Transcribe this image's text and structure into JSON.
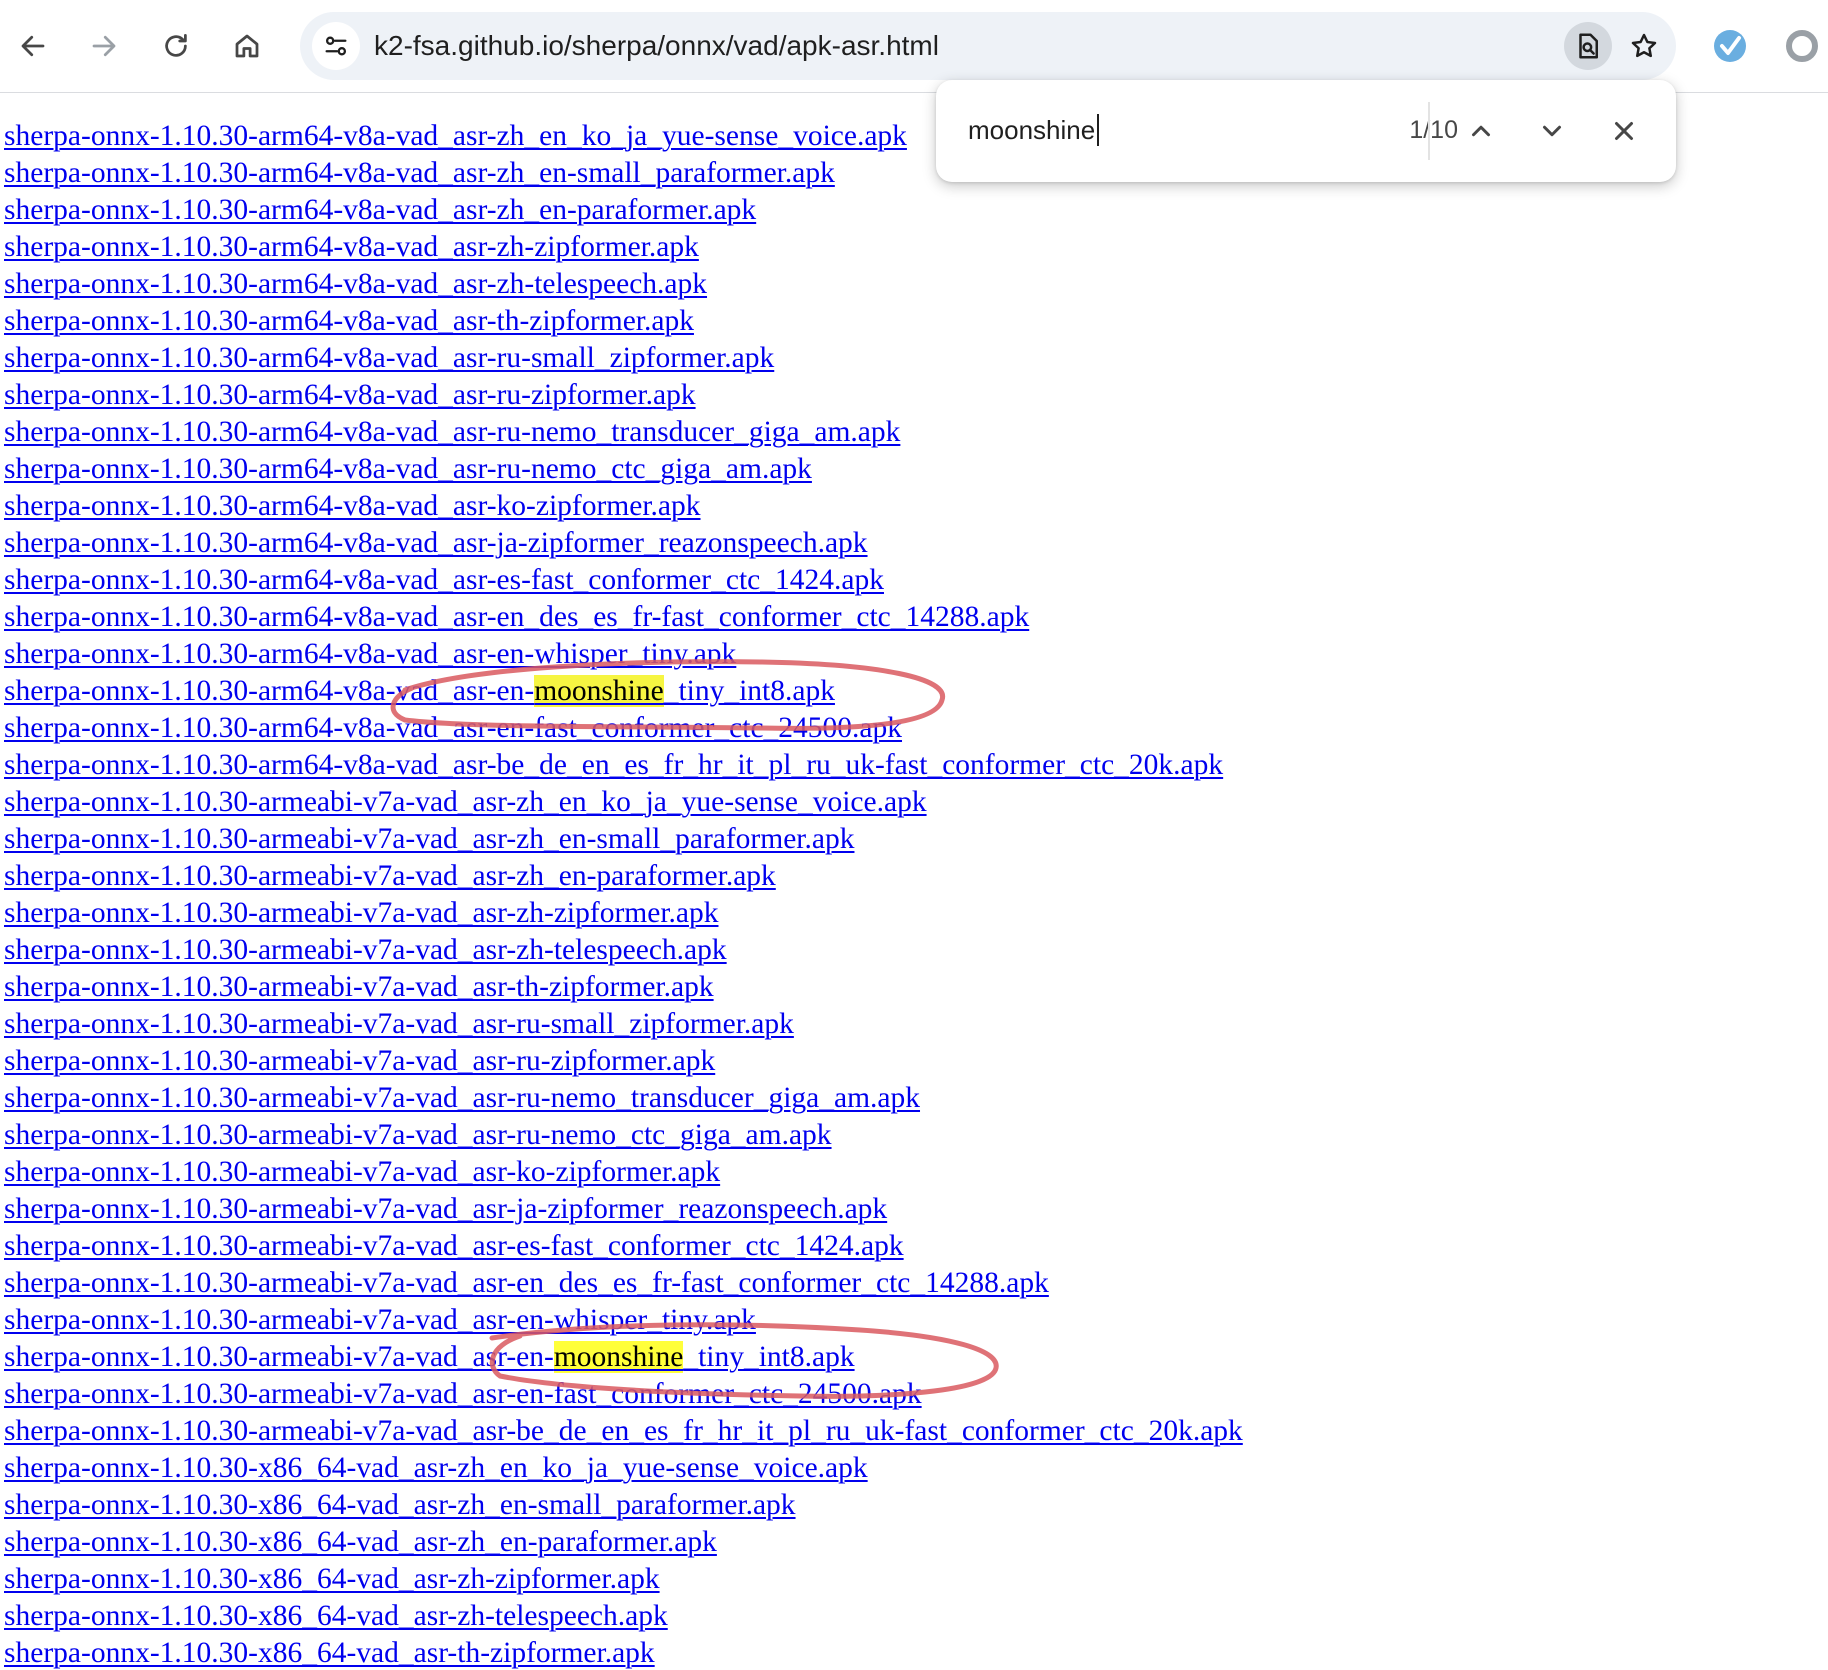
{
  "browser": {
    "url": "k2-fsa.github.io/sherpa/onnx/vad/apk-asr.html",
    "icons": {
      "back": "arrow-left-icon",
      "forward": "arrow-right-icon",
      "reload": "reload-icon",
      "home": "home-icon",
      "site_info": "tune-icon",
      "page_search": "find-in-page-icon",
      "bookmark": "star-icon",
      "extension_1": "extension-check-icon",
      "extension_2": "extension-circle-icon"
    }
  },
  "find_bar": {
    "query": "moonshine",
    "count": "1/10",
    "icons": {
      "previous": "chevron-up-icon",
      "next": "chevron-down-icon",
      "close": "close-icon"
    }
  },
  "colors": {
    "link": "#0000ee",
    "highlight": "#ffff3a",
    "annotation": "#d9595f"
  },
  "links": [
    {
      "text": "sherpa-onnx-1.10.30-arm64-v8a-vad_asr-zh_en_ko_ja_yue-sense_voice.apk"
    },
    {
      "text": "sherpa-onnx-1.10.30-arm64-v8a-vad_asr-zh_en-small_paraformer.apk"
    },
    {
      "text": "sherpa-onnx-1.10.30-arm64-v8a-vad_asr-zh_en-paraformer.apk"
    },
    {
      "text": "sherpa-onnx-1.10.30-arm64-v8a-vad_asr-zh-zipformer.apk"
    },
    {
      "text": "sherpa-onnx-1.10.30-arm64-v8a-vad_asr-zh-telespeech.apk"
    },
    {
      "text": "sherpa-onnx-1.10.30-arm64-v8a-vad_asr-th-zipformer.apk"
    },
    {
      "text": "sherpa-onnx-1.10.30-arm64-v8a-vad_asr-ru-small_zipformer.apk"
    },
    {
      "text": "sherpa-onnx-1.10.30-arm64-v8a-vad_asr-ru-zipformer.apk"
    },
    {
      "text": "sherpa-onnx-1.10.30-arm64-v8a-vad_asr-ru-nemo_transducer_giga_am.apk"
    },
    {
      "text": "sherpa-onnx-1.10.30-arm64-v8a-vad_asr-ru-nemo_ctc_giga_am.apk"
    },
    {
      "text": "sherpa-onnx-1.10.30-arm64-v8a-vad_asr-ko-zipformer.apk"
    },
    {
      "text": "sherpa-onnx-1.10.30-arm64-v8a-vad_asr-ja-zipformer_reazonspeech.apk"
    },
    {
      "text": "sherpa-onnx-1.10.30-arm64-v8a-vad_asr-es-fast_conformer_ctc_1424.apk"
    },
    {
      "text": "sherpa-onnx-1.10.30-arm64-v8a-vad_asr-en_des_es_fr-fast_conformer_ctc_14288.apk"
    },
    {
      "text": "sherpa-onnx-1.10.30-arm64-v8a-vad_asr-en-whisper_tiny.apk"
    },
    {
      "pre": "sherpa-onnx-1.10.30-arm64-v8a-vad_asr-en-",
      "match": "moonshine",
      "post": "_tiny_int8.apk",
      "current": true
    },
    {
      "text": "sherpa-onnx-1.10.30-arm64-v8a-vad_asr-en-fast_conformer_ctc_24500.apk"
    },
    {
      "text": "sherpa-onnx-1.10.30-arm64-v8a-vad_asr-be_de_en_es_fr_hr_it_pl_ru_uk-fast_conformer_ctc_20k.apk"
    },
    {
      "text": "sherpa-onnx-1.10.30-armeabi-v7a-vad_asr-zh_en_ko_ja_yue-sense_voice.apk"
    },
    {
      "text": "sherpa-onnx-1.10.30-armeabi-v7a-vad_asr-zh_en-small_paraformer.apk"
    },
    {
      "text": "sherpa-onnx-1.10.30-armeabi-v7a-vad_asr-zh_en-paraformer.apk"
    },
    {
      "text": "sherpa-onnx-1.10.30-armeabi-v7a-vad_asr-zh-zipformer.apk"
    },
    {
      "text": "sherpa-onnx-1.10.30-armeabi-v7a-vad_asr-zh-telespeech.apk"
    },
    {
      "text": "sherpa-onnx-1.10.30-armeabi-v7a-vad_asr-th-zipformer.apk"
    },
    {
      "text": "sherpa-onnx-1.10.30-armeabi-v7a-vad_asr-ru-small_zipformer.apk"
    },
    {
      "text": "sherpa-onnx-1.10.30-armeabi-v7a-vad_asr-ru-zipformer.apk"
    },
    {
      "text": "sherpa-onnx-1.10.30-armeabi-v7a-vad_asr-ru-nemo_transducer_giga_am.apk"
    },
    {
      "text": "sherpa-onnx-1.10.30-armeabi-v7a-vad_asr-ru-nemo_ctc_giga_am.apk"
    },
    {
      "text": "sherpa-onnx-1.10.30-armeabi-v7a-vad_asr-ko-zipformer.apk"
    },
    {
      "text": "sherpa-onnx-1.10.30-armeabi-v7a-vad_asr-ja-zipformer_reazonspeech.apk"
    },
    {
      "text": "sherpa-onnx-1.10.30-armeabi-v7a-vad_asr-es-fast_conformer_ctc_1424.apk"
    },
    {
      "text": "sherpa-onnx-1.10.30-armeabi-v7a-vad_asr-en_des_es_fr-fast_conformer_ctc_14288.apk"
    },
    {
      "text": "sherpa-onnx-1.10.30-armeabi-v7a-vad_asr-en-whisper_tiny.apk"
    },
    {
      "pre": "sherpa-onnx-1.10.30-armeabi-v7a-vad_asr-en-",
      "match": "moonshine",
      "post": "_tiny_int8.apk"
    },
    {
      "text": "sherpa-onnx-1.10.30-armeabi-v7a-vad_asr-en-fast_conformer_ctc_24500.apk"
    },
    {
      "text": "sherpa-onnx-1.10.30-armeabi-v7a-vad_asr-be_de_en_es_fr_hr_it_pl_ru_uk-fast_conformer_ctc_20k.apk"
    },
    {
      "text": "sherpa-onnx-1.10.30-x86_64-vad_asr-zh_en_ko_ja_yue-sense_voice.apk"
    },
    {
      "text": "sherpa-onnx-1.10.30-x86_64-vad_asr-zh_en-small_paraformer.apk"
    },
    {
      "text": "sherpa-onnx-1.10.30-x86_64-vad_asr-zh_en-paraformer.apk"
    },
    {
      "text": "sherpa-onnx-1.10.30-x86_64-vad_asr-zh-zipformer.apk"
    },
    {
      "text": "sherpa-onnx-1.10.30-x86_64-vad_asr-zh-telespeech.apk"
    },
    {
      "text": "sherpa-onnx-1.10.30-x86_64-vad_asr-th-zipformer.apk"
    }
  ]
}
